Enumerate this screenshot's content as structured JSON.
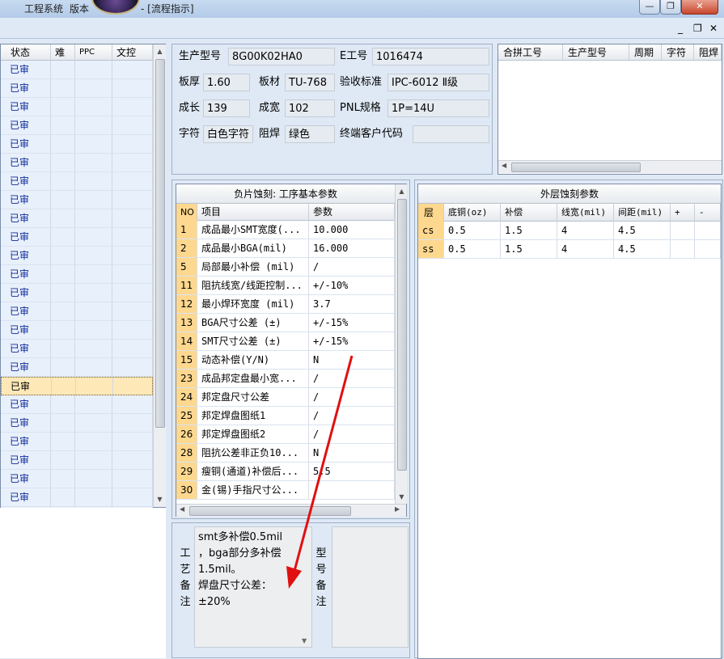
{
  "window": {
    "title_app": "工程系统",
    "title_version": "版本",
    "title_suffix": "- [流程指示]",
    "btn_min": "—",
    "btn_restore": "❐",
    "btn_close": "✕",
    "mdi_min": "_",
    "mdi_restore": "❐",
    "mdi_close": "✕"
  },
  "left_grid": {
    "headers": [
      "状态",
      "难",
      "PPC",
      "文控"
    ],
    "status_value": "已审核",
    "row_count": 25,
    "selected_row": 18
  },
  "info": {
    "model_label": "生产型号",
    "model_value": "8G00K02HA0",
    "e_label": "E工号",
    "e_value": "1016474",
    "thickness_label": "板厚",
    "thickness_value": "1.60",
    "material_label": "板材",
    "material_value": "TU-768",
    "standard_label": "验收标准",
    "standard_value": "IPC-6012 Ⅱ级",
    "length_label": "成长",
    "length_value": "139",
    "width_label": "成宽",
    "width_value": "102",
    "pnl_label": "PNL规格",
    "pnl_value": "1P=14U",
    "char_label": "字符",
    "char_value": "白色字符",
    "mask_label": "阻焊",
    "mask_value": "绿色",
    "customer_label": "终端客户代码",
    "customer_value": ""
  },
  "top_right_grid": {
    "headers": [
      "合拼工号",
      "生产型号",
      "周期",
      "字符",
      "阻焊"
    ]
  },
  "params": {
    "title": "负片蚀刻: 工序基本参数",
    "headers": [
      "NO",
      "项目",
      "参数"
    ],
    "rows": [
      {
        "no": "1",
        "item": "成品最小SMT宽度(...",
        "value": "10.000"
      },
      {
        "no": "2",
        "item": "成品最小BGA(mil)",
        "value": "16.000"
      },
      {
        "no": "5",
        "item": "局部最小补偿 (mil)",
        "value": "/"
      },
      {
        "no": "11",
        "item": "阻抗线宽/线距控制...",
        "value": "+/-10%"
      },
      {
        "no": "12",
        "item": "最小焊环宽度 (mil)",
        "value": "3.7"
      },
      {
        "no": "13",
        "item": "BGA尺寸公差 (±)",
        "value": "+/-15%"
      },
      {
        "no": "14",
        "item": "SMT尺寸公差 (±)",
        "value": "+/-15%"
      },
      {
        "no": "15",
        "item": "动态补偿(Y/N)",
        "value": "N"
      },
      {
        "no": "23",
        "item": "成品邦定盘最小宽...",
        "value": "/"
      },
      {
        "no": "24",
        "item": "邦定盘尺寸公差",
        "value": "/"
      },
      {
        "no": "25",
        "item": "邦定焊盘图纸1",
        "value": "/"
      },
      {
        "no": "26",
        "item": "邦定焊盘图纸2",
        "value": "/"
      },
      {
        "no": "28",
        "item": "阻抗公差非正负10...",
        "value": "N"
      },
      {
        "no": "29",
        "item": "瘦铜(通道)补偿后...",
        "value": "5.5"
      },
      {
        "no": "30",
        "item": "金(锡)手指尺寸公...",
        "value": ""
      }
    ]
  },
  "outer_etch": {
    "title": "外层蚀刻参数",
    "headers": [
      "层",
      "底铜(oz)",
      "补偿",
      "线宽(mil)",
      "间距(mil)",
      "+",
      "-"
    ],
    "rows": [
      {
        "layer": "cs",
        "base": "0.5",
        "comp": "1.5",
        "width": "4",
        "space": "4.5"
      },
      {
        "layer": "ss",
        "base": "0.5",
        "comp": "1.5",
        "width": "4",
        "space": "4.5"
      }
    ]
  },
  "remarks": {
    "process_label": [
      "工",
      "艺",
      "备",
      "注"
    ],
    "process_text": "smt多补偿0.5mil\n，bga部分多补偿\n1.5mil。\n焊盘尺寸公差：\n±20%",
    "model_label": [
      "型",
      "号",
      "备",
      "注"
    ],
    "model_text": ""
  },
  "colors": {
    "accent_selected": "#ffe8b8",
    "header_highlight": "#ffd88f",
    "status_text": "#0f2a9a",
    "annotation_arrow": "#e01010"
  }
}
